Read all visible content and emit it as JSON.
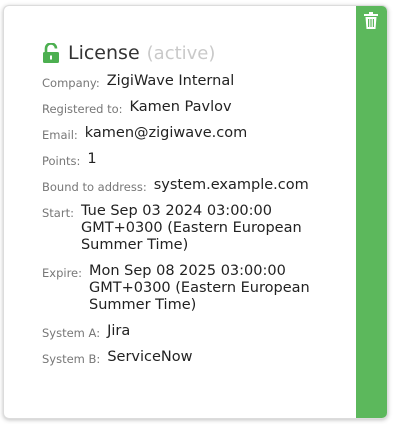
{
  "license": {
    "title": "License",
    "status": "(active)",
    "fields": [
      {
        "label": "Company:",
        "value": "ZigiWave Internal"
      },
      {
        "label": "Registered to:",
        "value": "Kamen Pavlov"
      },
      {
        "label": "Email:",
        "value": "kamen@zigiwave.com"
      },
      {
        "label": "Points:",
        "value": "1"
      },
      {
        "label": "Bound to address:",
        "value": "system.example.com"
      },
      {
        "label": "Start:",
        "value": "Tue Sep 03 2024 03:00:00 GMT+0300 (Eastern European Summer Time)"
      },
      {
        "label": "Expire:",
        "value": "Mon Sep 08 2025 03:00:00 GMT+0300 (Eastern European Summer Time)"
      },
      {
        "label": "System A:",
        "value": "Jira"
      },
      {
        "label": "System B:",
        "value": "ServiceNow"
      }
    ]
  },
  "icons": {
    "lock": "lock-open-icon",
    "delete": "trash-icon"
  },
  "colors": {
    "accent_green": "#5cb85c",
    "lock_green": "#4caf50"
  }
}
